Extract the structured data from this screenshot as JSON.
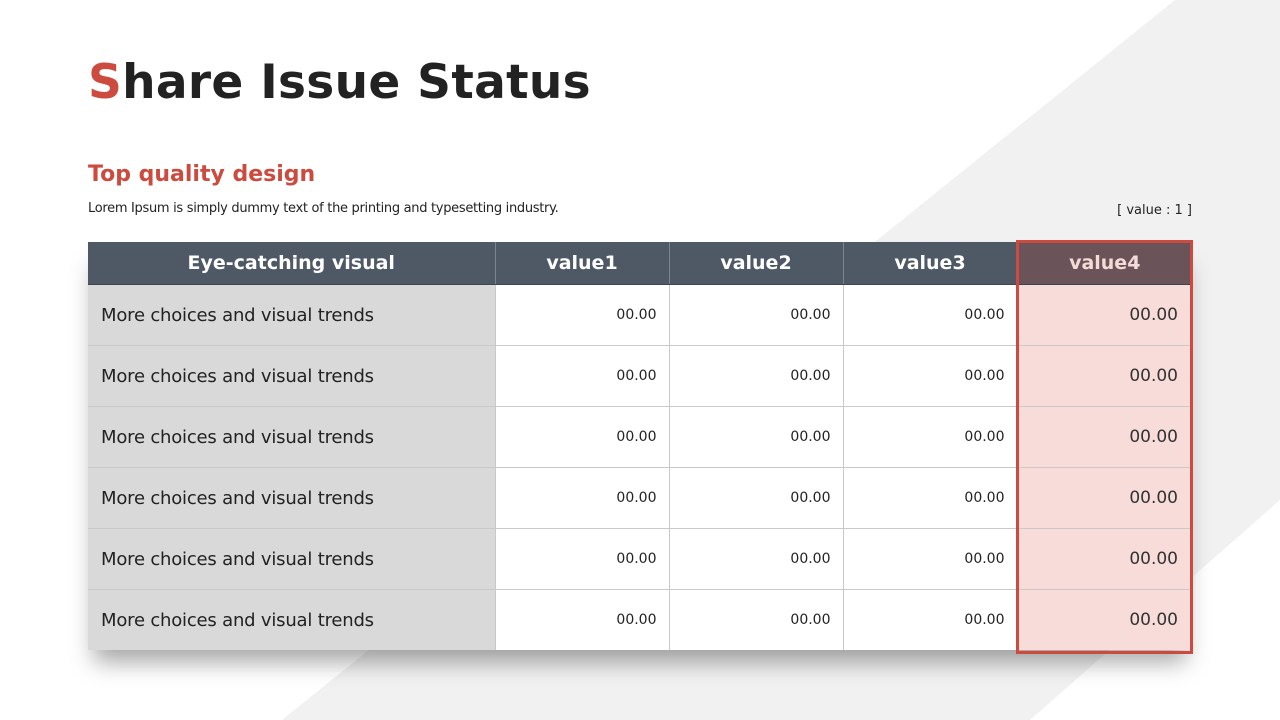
{
  "slide": {
    "title_accent": "S",
    "title_rest": "hare Issue Status",
    "subtitle": "Top quality design",
    "description": "Lorem Ipsum is simply dummy text of the printing and typesetting industry.",
    "unit_note": "[ value : 1 ]"
  },
  "table": {
    "headers": [
      "Eye-catching visual",
      "value1",
      "value2",
      "value3",
      "value4"
    ],
    "rows": [
      {
        "label": "More choices and visual trends",
        "values": [
          "00.00",
          "00.00",
          "00.00",
          "00.00"
        ]
      },
      {
        "label": "More choices and visual trends",
        "values": [
          "00.00",
          "00.00",
          "00.00",
          "00.00"
        ]
      },
      {
        "label": "More choices and visual trends",
        "values": [
          "00.00",
          "00.00",
          "00.00",
          "00.00"
        ]
      },
      {
        "label": "More choices and visual trends",
        "values": [
          "00.00",
          "00.00",
          "00.00",
          "00.00"
        ]
      },
      {
        "label": "More choices and visual trends",
        "values": [
          "00.00",
          "00.00",
          "00.00",
          "00.00"
        ]
      },
      {
        "label": "More choices and visual trends",
        "values": [
          "00.00",
          "00.00",
          "00.00",
          "00.00"
        ]
      }
    ],
    "highlighted_column": "value4"
  },
  "colors": {
    "accent": "#cd4a3e",
    "header_bg": "#4f5966",
    "label_cell_bg": "#d9d9d9",
    "highlight_cell_bg": "#f7dcd9",
    "background_shape": "#f1f1f1"
  }
}
